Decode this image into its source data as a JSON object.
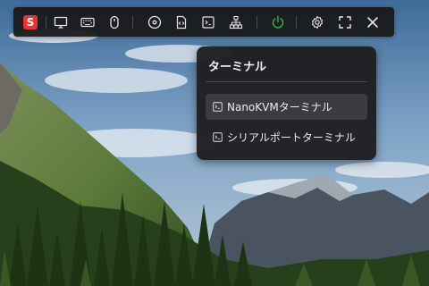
{
  "toolbar": {
    "logo": {
      "letter": "S",
      "color": "#e8352f"
    },
    "buttons": [
      {
        "name": "monitor-icon"
      },
      {
        "name": "keyboard-icon"
      },
      {
        "name": "mouse-icon"
      },
      {
        "name": "disc-icon"
      },
      {
        "name": "code-file-icon"
      },
      {
        "name": "terminal-icon"
      },
      {
        "name": "network-icon"
      },
      {
        "name": "power-icon",
        "color": "#3ab54a"
      },
      {
        "name": "gear-icon"
      },
      {
        "name": "fullscreen-icon"
      },
      {
        "name": "close-icon"
      }
    ]
  },
  "terminal_menu": {
    "title": "ターミナル",
    "items": [
      {
        "label": "NanoKVMターミナル",
        "icon": "terminal-icon",
        "active": true
      },
      {
        "label": "シリアルポートターミナル",
        "icon": "terminal-icon",
        "active": false
      }
    ]
  },
  "background": {
    "description_colors": {
      "sky": "#5b86b0",
      "forest": "#2e4a22",
      "mountain": "#4a5460"
    }
  }
}
